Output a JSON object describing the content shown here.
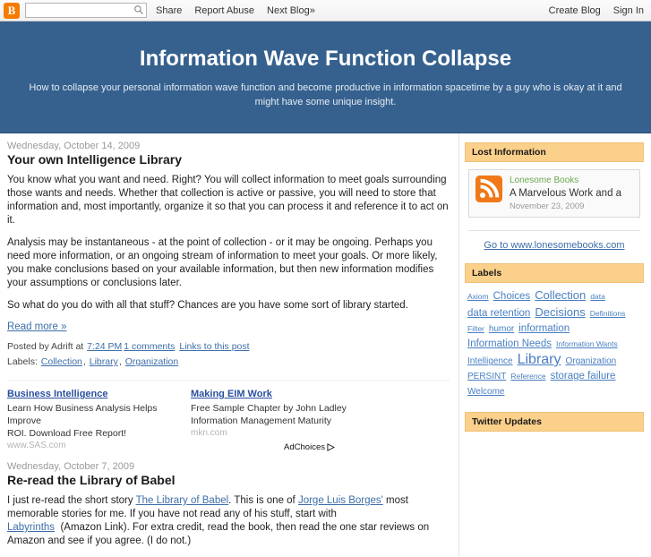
{
  "navbar": {
    "logo_letter": "B",
    "search_placeholder": "",
    "search_value": "",
    "search_icon": "search-icon",
    "links": [
      {
        "label": "Share"
      },
      {
        "label": "Report Abuse"
      },
      {
        "label": "Next Blog»"
      }
    ],
    "right_links": [
      {
        "label": "Create Blog"
      },
      {
        "label": "Sign In"
      }
    ]
  },
  "header": {
    "title": "Information Wave Function Collapse",
    "description": "How to collapse your personal information wave function and become productive in information spacetime by a guy who is okay at it and might have some unique insight.",
    "bg_color": "#36618e"
  },
  "posts": [
    {
      "date": "Wednesday, October 14, 2009",
      "title": "Your own Intelligence Library",
      "paragraphs": [
        "You know what you want and need. Right? You will collect information to meet goals surrounding those wants and needs. Whether that collection is active or passive, you will need to store that information and, most importantly, organize it so that you can process it and reference it to act on it.",
        "Analysis may be instantaneous - at the point of collection - or it may be ongoing. Perhaps you need more information, or an ongoing stream of information to meet your goals. Or more likely, you make conclusions based on your available information, but then new information modifies your assumptions or conclusions later.",
        "So what do you do with all that stuff? Chances are you have some sort of library started."
      ],
      "read_more": "Read more »",
      "meta_prefix": "Posted by Adrift at",
      "meta_time": "7:24 PM",
      "meta_comments": "1 comments",
      "meta_links": "Links to this post",
      "labels_prefix": "Labels:",
      "labels": [
        "Collection",
        "Library",
        "Organization"
      ]
    }
  ],
  "ads": {
    "items": [
      {
        "title": "Business Intelligence",
        "line1": "Learn How Business Analysis Helps Improve",
        "line2": "ROI. Download Free Report!",
        "url": "www.SAS.com"
      },
      {
        "title": "Making EIM Work",
        "line1": "Free Sample Chapter by John Ladley",
        "line2": "Information Management Maturity",
        "url": "mkn.com"
      }
    ],
    "adchoices_label": "AdChoices"
  },
  "post2": {
    "date": "Wednesday, October 7, 2009",
    "title": "Re-read the Library of Babel",
    "t1": "I just re-read the short story ",
    "link1": "The Library of Babel",
    "t2": ". This is one of ",
    "link2": "Jorge Luis Borges'",
    "t3": " most memorable stories for me. If you have not read any of his stuff, start with",
    "link3": "Labyrinths",
    "t4": "(Amazon Link). For extra credit, read the book, then read the one star reviews on Amazon and see if you agree. (I do not.)"
  },
  "sidebar": {
    "lost_information": {
      "heading": "Lost Information",
      "feed": {
        "source": "Lonesome Books",
        "title": "A Marvelous Work and a",
        "date": "November 23, 2009",
        "icon": "rss-icon"
      },
      "link": "Go to www.lonesomebooks.com"
    },
    "labels_widget": {
      "heading": "Labels",
      "tags": [
        {
          "label": "Axiom",
          "size": "s1"
        },
        {
          "label": "Choices",
          "size": "s3"
        },
        {
          "label": "Collection",
          "size": "s4"
        },
        {
          "label": "data",
          "size": "s1"
        },
        {
          "label": "data retention",
          "size": "s3"
        },
        {
          "label": "Decisions",
          "size": "s4"
        },
        {
          "label": "Definitions",
          "size": "s1"
        },
        {
          "label": "Filter",
          "size": "s1"
        },
        {
          "label": "humor",
          "size": "s2"
        },
        {
          "label": "information",
          "size": "s3"
        },
        {
          "label": "Information Needs",
          "size": "s3"
        },
        {
          "label": "Information Wants",
          "size": "s1"
        },
        {
          "label": "Intelligence",
          "size": "s2"
        },
        {
          "label": "Library",
          "size": "s5"
        },
        {
          "label": "Organization",
          "size": "s2"
        },
        {
          "label": "PERSINT",
          "size": "s2"
        },
        {
          "label": "Reference",
          "size": "s1"
        },
        {
          "label": "storage failure",
          "size": "s3"
        },
        {
          "label": "Welcome",
          "size": "s2"
        }
      ]
    },
    "twitter_widget": {
      "heading": "Twitter Updates"
    }
  },
  "colors": {
    "header_bg": "#36618e",
    "widget_head": "#fbd08a",
    "link": "#3d6ea8",
    "accent_orange": "#f57c00"
  }
}
